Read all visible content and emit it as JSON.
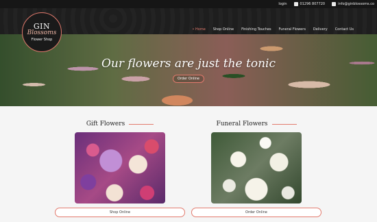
{
  "topbar": {
    "login": "login",
    "phone": "01296 807720",
    "email": "info@ginblossoms.co"
  },
  "logo": {
    "line1": "GIN",
    "line2": "Blossoms",
    "line3": "Flower Shop"
  },
  "menu": [
    {
      "label": "Home",
      "active": true
    },
    {
      "label": "Shop Online"
    },
    {
      "label": "Finishing Touches"
    },
    {
      "label": "Funeral Flowers"
    },
    {
      "label": "Delivery"
    },
    {
      "label": "Contact Us"
    }
  ],
  "hero": {
    "tagline": "Our flowers are just the tonic",
    "button": "Order Online"
  },
  "cards": [
    {
      "title": "Gift Flowers",
      "button": "Shop Online"
    },
    {
      "title": "Funeral Flowers",
      "button": "Order Online"
    }
  ],
  "colors": {
    "accent": "#e27a6d",
    "header": "#1e1e1e",
    "topbar": "#161616"
  },
  "icons": [
    "phone-icon",
    "email-icon"
  ]
}
